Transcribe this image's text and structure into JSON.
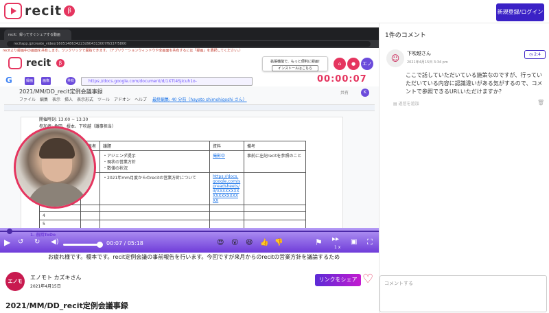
{
  "app": {
    "logo_text": "recit",
    "beta_badge": "β",
    "login_button": "新規登録/ログイン"
  },
  "video": {
    "browser_tab": "recit：録ってすぐシェアする動画",
    "browser_url": "recitapp.jp/create_video/1605148634223d904313007f6337f5800",
    "notice": "recitより録画中の画面を共有します。ワンクリックで開始できます。（アプリケーションウィンドウや全画面を共有するには「録画」を選択してください。）",
    "inner_logo": "recit",
    "install_prompt": "拡張機能で、もっと便利に録画!",
    "install_button": "インストールはこちら",
    "inner_avatar": "エノ",
    "notif_count": "1",
    "google_g": "G",
    "toolbar_labels": [
      "録画",
      "画像",
      "共有"
    ],
    "doc_url": "https://docs.google.com/document/d/1XTt4Sjicuh1o-jPT9NGN2_MSRVLy_fMACDAxaFgs",
    "timer": "00:00:07",
    "doc_title": "2021/MM/DD_recit定例会議事録",
    "doc_menu": "ファイル　編集　表示　挿入　表示形式　ツール　アドオン　ヘルプ",
    "doc_edit_note": "最終編集: 40 分前（hayato shimohigoshi さん）",
    "doc_share": "共有",
    "doc_user": "K",
    "doc_lines": [
      "開催時刻: 13:00 ~ 13:30",
      "参加者: 角田、榎本、下吹越（議事担当）"
    ],
    "table_header": [
      "",
      "発表者",
      "議題",
      "資料",
      "備考"
    ],
    "table_rows": [
      [
        "",
        "榎本",
        "・アジェンダ提示\n・現状の営業方針\n・数値の状況",
        "撮影中",
        "事前に左記recitを参照のこと"
      ],
      [
        "",
        "主宰",
        "・2021年mm月度からのrecitの営業方針について",
        "https://docs.google.com/spreadsheets/d/XXXXXXXXXXXXXXXXXXX",
        ""
      ],
      [
        "",
        "",
        "",
        "",
        ""
      ],
      [
        "4",
        "",
        "",
        "",
        ""
      ],
      [
        "5",
        "",
        "",
        "",
        ""
      ]
    ],
    "chapter": "1. 前回ToDo",
    "time": "00:07 / 05:18",
    "speed": "1 x",
    "subtitle": "お疲れ様です。榎本です。recit定例会議の事前報告を行います。今回ですが来月からのrecitの営業方針を議論するため"
  },
  "uploader": {
    "avatar": "エノモ",
    "name": "エノモト カズキさん",
    "date": "2021年4月15日",
    "share_button": "リンクをシェア"
  },
  "page_title": "2021/MM/DD_recit定例会議事録",
  "comments": {
    "count_label": "1件のコメント",
    "items": [
      {
        "author": "下吹越さん",
        "date": "2021年4月15日 3:34 pm",
        "timestamp": "2:4",
        "text": "ここで話していただいている施策なのですが、行っていただいている内容に認識違いがある気がするので、コメントで参照できるURLいただけますか？",
        "reply_placeholder": "返信を追加"
      }
    ],
    "input_placeholder": "コメントする"
  }
}
